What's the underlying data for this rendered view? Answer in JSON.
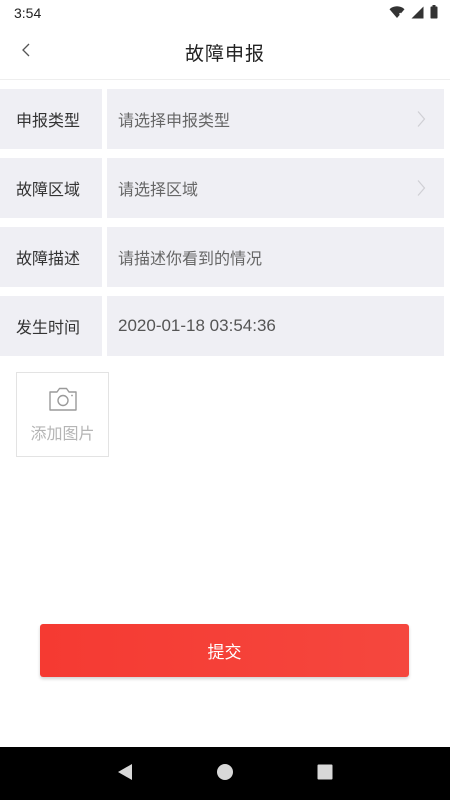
{
  "status_bar": {
    "time": "3:54",
    "icons": [
      "wifi-icon",
      "cellular-signal-icon",
      "battery-icon"
    ]
  },
  "header": {
    "title": "故障申报",
    "back_icon": "chevron-left-icon"
  },
  "form": {
    "rows": [
      {
        "label": "申报类型",
        "value": "请选择申报类型",
        "has_chevron": true
      },
      {
        "label": "故障区域",
        "value": "请选择区域",
        "has_chevron": true
      },
      {
        "label": "故障描述",
        "value": "请描述你看到的情况",
        "has_chevron": false
      },
      {
        "label": "发生时间",
        "value": "2020-01-18 03:54:36",
        "has_chevron": false
      }
    ]
  },
  "add_photo": {
    "label": "添加图片",
    "icon": "camera-icon"
  },
  "submit": {
    "label": "提交"
  },
  "colors": {
    "accent": "#f53a32",
    "row_background": "#efeff4",
    "nav_bar": "#000000"
  },
  "nav_bar": {
    "icons": [
      "back-triangle-icon",
      "home-circle-icon",
      "recents-square-icon"
    ]
  }
}
